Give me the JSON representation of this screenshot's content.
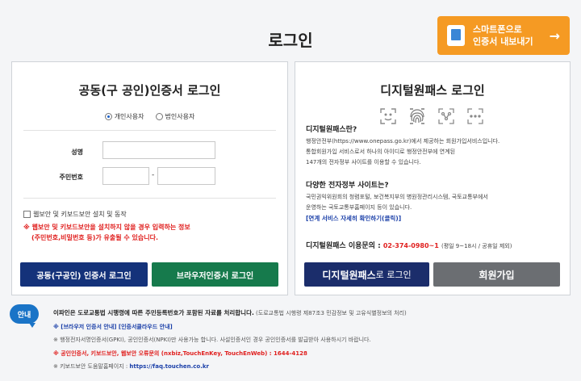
{
  "page_title": "로그인",
  "smart_button": {
    "line1": "스마트폰으로",
    "line2": "인증서 내보내기",
    "arrow": "→",
    "icon": "smartphone-icon"
  },
  "cert_login": {
    "title": "공동(구 공인)인증서 로그인",
    "radio_personal": "개인사용자",
    "radio_corporate": "법인사용자",
    "selected": "개인사용자",
    "name_label": "성명",
    "name_value": "",
    "rrn_label": "주민번호",
    "rrn_front_value": "",
    "rrn_back_value": "",
    "dash": "-",
    "checkbox_label": "웹보안 및 키보드보안 설치 및 동작",
    "warning_line1": "※ 웹보안 및 키보드보안을 설치하지 않을 경우 입력하는 정보",
    "warning_line2": "(주민번호,비밀번호 등)가 유출될 수 있습니다.",
    "btn_joint_cert": "공동(구공인) 인증서 로그인",
    "btn_browser_cert": "브라우저인증서 로그인"
  },
  "digital_onepass": {
    "title": "디지털원패스 로그인",
    "icons": [
      "face-scan-icon",
      "fingerprint-icon",
      "pattern-icon",
      "pin-icon"
    ],
    "what_head": "디지털원패스란?",
    "what_line1": "행정안전부(https://www.onepass.go.kr)에서 제공하는 회원가입서비스입니다.",
    "what_line2": "통합회원가입 서비스로서 하나의 아이디로 행정안전부에 연계된",
    "what_line3": "147개의 전자정부 사이트를 이용할 수 있습니다.",
    "sites_head": "다양한 전자정부 사이트는?",
    "sites_line1": "국민권익위원회의 청렴포털, 보건복지부의 병원정관리시스템, 국토교통부에서",
    "sites_line2": "운영하는 국토교통부홈페이지 등이 있습니다.",
    "sites_link": "[연계 서비스 자세히 확인하기(클릭)]",
    "contact_label": "디지털원패스 이용문의 :",
    "contact_number": "02-374-0980~1",
    "contact_note": "(평일 9~18시 / 공휴일 제외)",
    "btn_login_bold": "디지털원패스",
    "btn_login_rest": " 로 로그인",
    "btn_signup": "회원가입"
  },
  "notice": {
    "badge": "안내",
    "line1_bold": "이파인은 도로교통법 시행령에 따른 주민등록번호가 포함된 자료를 처리합니다.",
    "line1_rest": " (도로교통법 시행령 제87조3 민감정보 및 고유식별정보의 처리)",
    "line2": "※ [브라우저 인증서 안내] [인증서클라우드 안내]",
    "line3": "※ 행정전자서명인증서(GPKI), 공인인증서(NPKI)만 사용가능 합니다. 사설인증서인 경우 공인인증서를 발급받아 사용하시기 바랍니다.",
    "line4": "※ 공인인증서, 키보드보안, 웹보안 오류문의 (nxbiz,TouchEnKey, TouchEnWeb) : 1644-4128",
    "line5_prefix": "※ 키보드보안 도움말홈페이지 : ",
    "line5_link": "https://faq.touchen.co.kr"
  },
  "colors": {
    "accent_orange": "#f59a23",
    "navy": "#14327a",
    "green": "#167a4c",
    "gray_button": "#6b6e72",
    "warning_red": "#e0201f",
    "link_blue": "#1a3fa8"
  }
}
